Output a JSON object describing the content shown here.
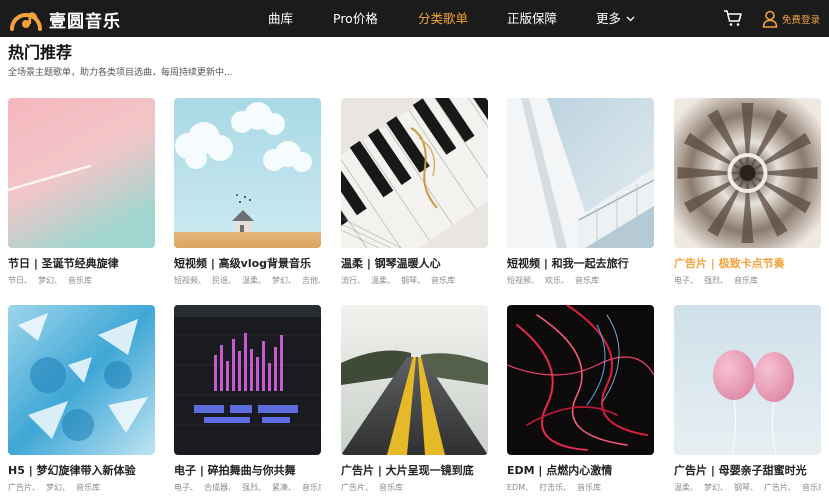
{
  "header": {
    "brand": "壹圆音乐",
    "nav": [
      {
        "label": "曲库",
        "active": false
      },
      {
        "label": "Pro价格",
        "active": false
      },
      {
        "label": "分类歌单",
        "active": true
      },
      {
        "label": "正版保障",
        "active": false
      },
      {
        "label": "更多",
        "active": false
      }
    ],
    "login_label": "免费登录",
    "accent_color": "#f2a33a"
  },
  "section": {
    "title": "热门推荐",
    "subtitle": "全场景主题歌单，助力各类项目选曲，每周持续更新中..."
  },
  "cards": [
    {
      "title": "节日 | 圣诞节经典旋律",
      "tags": [
        "节日、",
        "梦幻、",
        "音乐库"
      ],
      "highlight": false,
      "image": "pink-sky"
    },
    {
      "title": "短视频 | 高级vlog背景音乐",
      "tags": [
        "短视频、",
        "民谣、",
        "温柔、",
        "梦幻、",
        "吉他..."
      ],
      "highlight": false,
      "image": "clouds-house"
    },
    {
      "title": "温柔 | 钢琴温暖人心",
      "tags": [
        "流行、",
        "温柔、",
        "钢琴、",
        "音乐库"
      ],
      "highlight": false,
      "image": "piano"
    },
    {
      "title": "短视频 | 和我一起去旅行",
      "tags": [
        "短视频、",
        "欢乐、",
        "音乐库"
      ],
      "highlight": false,
      "image": "building"
    },
    {
      "title": "广告片 | 极致卡点节奏",
      "tags": [
        "电子、",
        "强烈、",
        "音乐库"
      ],
      "highlight": true,
      "image": "kaleidoscope"
    },
    {
      "title": "H5 | 梦幻旋律带入新体验",
      "tags": [
        "广告片、",
        "梦幻、",
        "音乐库"
      ],
      "highlight": false,
      "image": "watercolor"
    },
    {
      "title": "电子 | 碎拍舞曲与你共舞",
      "tags": [
        "电子、",
        "合成器、",
        "强烈、",
        "紧凑、",
        "音乐库"
      ],
      "highlight": false,
      "image": "daw"
    },
    {
      "title": "广告片 | 大片呈现一镜到底",
      "tags": [
        "广告片、",
        "音乐库"
      ],
      "highlight": false,
      "image": "road"
    },
    {
      "title": "EDM | 点燃内心激情",
      "tags": [
        "EDM、",
        "打击乐、",
        "音乐库"
      ],
      "highlight": false,
      "image": "light-trails"
    },
    {
      "title": "广告片 | 母婴亲子甜蜜时光",
      "tags": [
        "温柔、",
        "梦幻、",
        "钢琴、",
        "广告片、",
        "音乐库"
      ],
      "highlight": false,
      "image": "balloons"
    }
  ]
}
